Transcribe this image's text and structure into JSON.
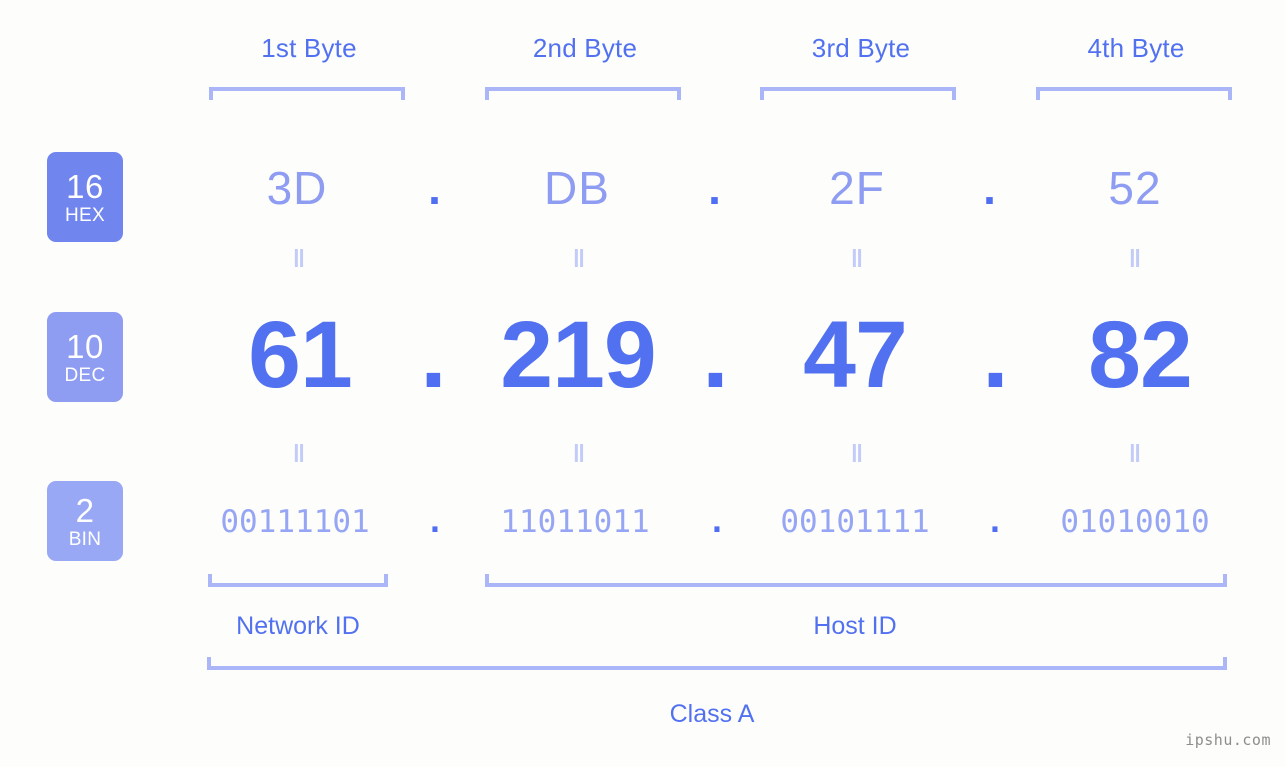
{
  "background_color": "#fdfefb",
  "accent_colors": {
    "primary_blue": "#5271f0",
    "light_blue": "#8e9cf2",
    "pale_blue": "#aab6f7",
    "badge_hex": "#7185ee",
    "badge_dec": "#8e9cf2",
    "badge_bin": "#98a8f5",
    "watermark_gray": "#8d8d8d"
  },
  "byte_headers": [
    {
      "label": "1st Byte"
    },
    {
      "label": "2nd Byte"
    },
    {
      "label": "3rd Byte"
    },
    {
      "label": "4th Byte"
    }
  ],
  "radix_badges": [
    {
      "number": "16",
      "abbr": "HEX"
    },
    {
      "number": "10",
      "abbr": "DEC"
    },
    {
      "number": "2",
      "abbr": "BIN"
    }
  ],
  "separator": ".",
  "equals_mark": "=",
  "rows": {
    "hex": {
      "radix": "16",
      "name": "HEX",
      "octets": [
        "3D",
        "DB",
        "2F",
        "52"
      ]
    },
    "dec": {
      "radix": "10",
      "name": "DEC",
      "octets": [
        "61",
        "219",
        "47",
        "82"
      ]
    },
    "bin": {
      "radix": "2",
      "name": "BIN",
      "octets": [
        "00111101",
        "11011011",
        "00101111",
        "01010010"
      ]
    }
  },
  "ip_address": "61.219.47.82",
  "partition": {
    "network_id_label": "Network ID",
    "host_id_label": "Host ID",
    "class_label": "Class A"
  },
  "watermark": "ipshu.com"
}
